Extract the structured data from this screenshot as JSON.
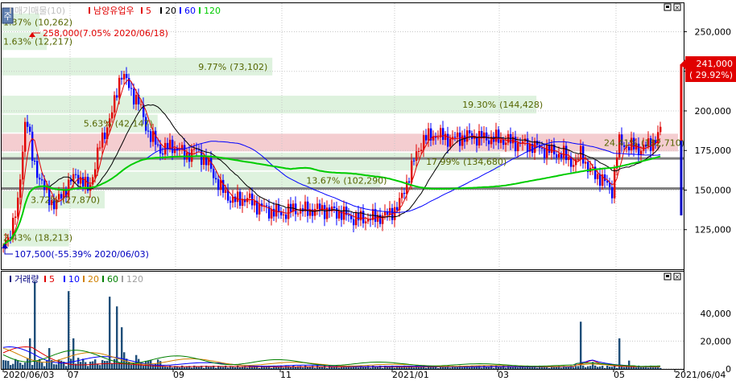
{
  "price_panel": {
    "legend": [
      {
        "text": "매기매물(10)",
        "color": "#c0c0c0"
      },
      {
        "text": "남양유업우",
        "color": "#e00000"
      },
      {
        "text": "5",
        "color": "#e00000"
      },
      {
        "text": "20",
        "color": "#000000"
      },
      {
        "text": "60",
        "color": "#0000ff"
      },
      {
        "text": "120",
        "color": "#00cc00"
      }
    ],
    "left_button": "주",
    "high_label": "258,000(7.05% 2020/06/18)",
    "low_label": "107,500(-55.39% 2020/06/03)",
    "current_price": "241,000",
    "current_change": "( 29.92%)",
    "ytick_labels": [
      "250,000",
      "225,000",
      "200,000",
      "175,000",
      "150,000",
      "125,000"
    ]
  },
  "volume_panel": {
    "legend": [
      {
        "text": "거래량",
        "color": "#000080"
      },
      {
        "text": "5",
        "color": "#e00000"
      },
      {
        "text": "10",
        "color": "#0000ff"
      },
      {
        "text": "20",
        "color": "#d08000"
      },
      {
        "text": "60",
        "color": "#008000"
      },
      {
        "text": "120",
        "color": "#a0a0a0"
      }
    ],
    "ytick_labels": [
      "40,000",
      "20,000",
      "0"
    ]
  },
  "xaxis_labels": [
    "2020/06/03",
    "07",
    "09",
    "11",
    "2021/01",
    "03",
    "05",
    "2021/06/04"
  ],
  "chart_data": [
    {
      "type": "bar",
      "title": "남양유업우",
      "description_free": true,
      "ylim": [
        100000,
        268000
      ],
      "yticks": [
        125000,
        150000,
        175000,
        200000,
        225000,
        250000
      ],
      "current": 241000,
      "high": {
        "value": 258000,
        "pct": "7.05%",
        "date": "2020/06/18"
      },
      "low": {
        "value": 107500,
        "pct": "-55.39%",
        "date": "2020/06/03"
      },
      "volume_profile": [
        {
          "price": 256000,
          "label": "1.37%",
          "volume": "(10,262)",
          "pct": 1.37
        },
        {
          "price": 244000,
          "label": "1.63%",
          "volume": "(12,217)",
          "pct": 1.63
        },
        {
          "price": 228000,
          "label": "9.77%",
          "volume": "(73,102)",
          "pct": 9.77
        },
        {
          "price": 204000,
          "label": "19.30%",
          "volume": "(144,428)",
          "pct": 19.3
        },
        {
          "price": 192000,
          "label": "5.63%",
          "volume": "(42,147)",
          "pct": 5.63
        },
        {
          "price": 180000,
          "label": "24.41%",
          "volume": "(182,710)",
          "pct": 24.41
        },
        {
          "price": 168000,
          "label": "17.99%",
          "volume": "(134,680)",
          "pct": 17.99
        },
        {
          "price": 156000,
          "label": "13.67%",
          "volume": "(102,290)",
          "pct": 13.67
        },
        {
          "price": 144000,
          "label": "3.72%",
          "volume": "(27,870)",
          "pct": 3.72
        },
        {
          "price": 120000,
          "label": "2.43%",
          "volume": "(18,213)",
          "pct": 2.43
        }
      ],
      "horizontal_lines": [
        {
          "price": 170000,
          "color": "#808080"
        },
        {
          "price": 151000,
          "color": "#808080"
        }
      ],
      "close_anchors": [
        {
          "x": 0,
          "y": 110000
        },
        {
          "x": 10,
          "y": 120000
        },
        {
          "x": 22,
          "y": 140000
        },
        {
          "x": 32,
          "y": 200000
        },
        {
          "x": 40,
          "y": 170000
        },
        {
          "x": 55,
          "y": 150000
        },
        {
          "x": 68,
          "y": 140000
        },
        {
          "x": 80,
          "y": 150000
        },
        {
          "x": 95,
          "y": 160000
        },
        {
          "x": 110,
          "y": 150000
        },
        {
          "x": 125,
          "y": 180000
        },
        {
          "x": 140,
          "y": 200000
        },
        {
          "x": 150,
          "y": 225000
        },
        {
          "x": 160,
          "y": 215000
        },
        {
          "x": 172,
          "y": 205000
        },
        {
          "x": 185,
          "y": 185000
        },
        {
          "x": 200,
          "y": 175000
        },
        {
          "x": 215,
          "y": 178000
        },
        {
          "x": 230,
          "y": 172000
        },
        {
          "x": 245,
          "y": 175000
        },
        {
          "x": 260,
          "y": 165000
        },
        {
          "x": 275,
          "y": 150000
        },
        {
          "x": 290,
          "y": 143000
        },
        {
          "x": 305,
          "y": 145000
        },
        {
          "x": 320,
          "y": 140000
        },
        {
          "x": 335,
          "y": 137000
        },
        {
          "x": 350,
          "y": 135000
        },
        {
          "x": 365,
          "y": 138000
        },
        {
          "x": 380,
          "y": 137000
        },
        {
          "x": 400,
          "y": 138000
        },
        {
          "x": 420,
          "y": 136000
        },
        {
          "x": 440,
          "y": 132000
        },
        {
          "x": 460,
          "y": 132000
        },
        {
          "x": 480,
          "y": 134000
        },
        {
          "x": 495,
          "y": 140000
        },
        {
          "x": 505,
          "y": 155000
        },
        {
          "x": 515,
          "y": 170000
        },
        {
          "x": 525,
          "y": 182000
        },
        {
          "x": 540,
          "y": 185000
        },
        {
          "x": 560,
          "y": 182000
        },
        {
          "x": 580,
          "y": 184000
        },
        {
          "x": 600,
          "y": 183000
        },
        {
          "x": 620,
          "y": 182000
        },
        {
          "x": 640,
          "y": 180000
        },
        {
          "x": 660,
          "y": 178000
        },
        {
          "x": 680,
          "y": 175000
        },
        {
          "x": 700,
          "y": 172000
        },
        {
          "x": 715,
          "y": 166000
        },
        {
          "x": 722,
          "y": 175000
        },
        {
          "x": 730,
          "y": 163000
        },
        {
          "x": 745,
          "y": 158000
        },
        {
          "x": 760,
          "y": 150000
        },
        {
          "x": 768,
          "y": 180000
        },
        {
          "x": 780,
          "y": 178000
        },
        {
          "x": 795,
          "y": 176000
        },
        {
          "x": 805,
          "y": 178000
        },
        {
          "x": 815,
          "y": 183000
        },
        {
          "x": 822,
          "y": 188000
        }
      ],
      "volume_spikes": [
        {
          "x": 38,
          "v": 22000
        },
        {
          "x": 43,
          "v": 63000
        },
        {
          "x": 60,
          "v": 15000
        },
        {
          "x": 85,
          "v": 56000
        },
        {
          "x": 90,
          "v": 22000
        },
        {
          "x": 98,
          "v": 8000
        },
        {
          "x": 137,
          "v": 52000
        },
        {
          "x": 145,
          "v": 45000
        },
        {
          "x": 150,
          "v": 30000
        },
        {
          "x": 155,
          "v": 12000
        },
        {
          "x": 170,
          "v": 10000
        },
        {
          "x": 185,
          "v": 6000
        },
        {
          "x": 720,
          "v": 34000
        },
        {
          "x": 735,
          "v": 5000
        },
        {
          "x": 768,
          "v": 22000
        },
        {
          "x": 780,
          "v": 6000
        },
        {
          "x": 822,
          "v": 12000
        }
      ]
    }
  ]
}
